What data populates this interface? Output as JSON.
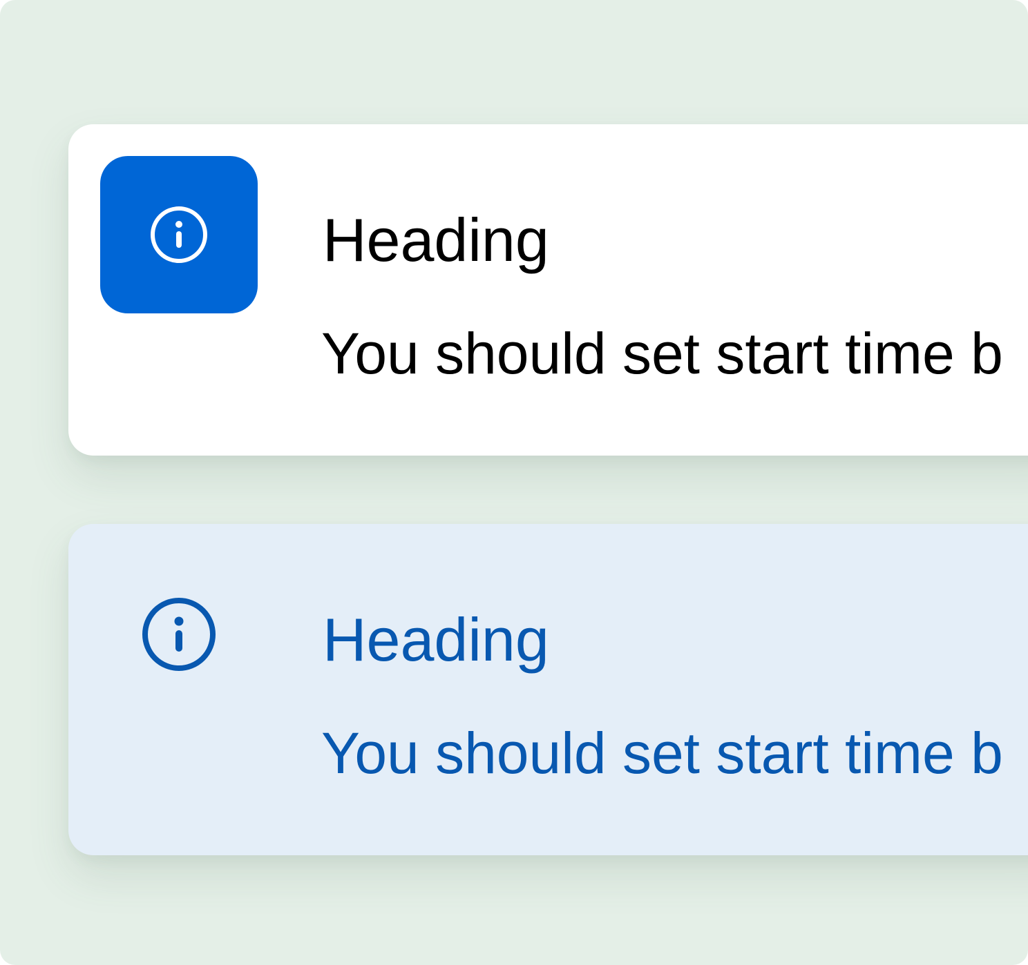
{
  "colors": {
    "background": "#e4efe7",
    "solid_card": "#ffffff",
    "tinted_card": "#e4eef8",
    "icon_tile": "#0066d6",
    "tinted_text": "#0858b0",
    "solid_text": "#000000"
  },
  "alerts": [
    {
      "variant": "solid",
      "icon": "info-icon",
      "heading": "Heading",
      "body": "You should set start time b"
    },
    {
      "variant": "tinted",
      "icon": "info-icon",
      "heading": "Heading",
      "body": "You should set start time b"
    }
  ]
}
